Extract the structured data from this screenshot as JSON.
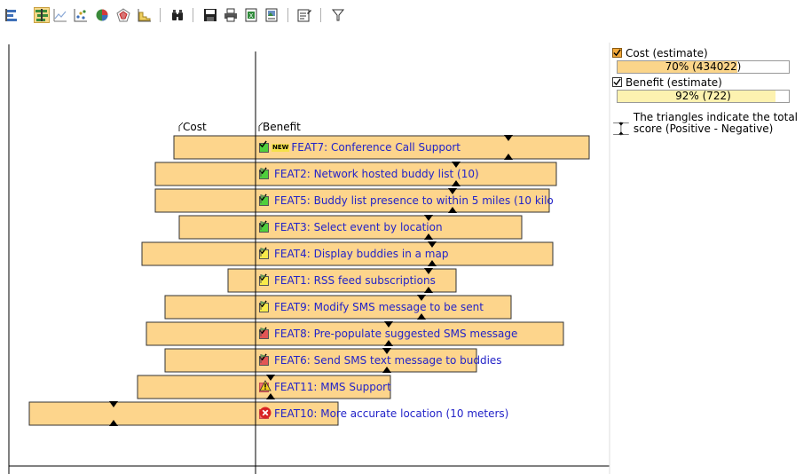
{
  "toolbar": {
    "buttons": [
      {
        "icon": "bars-left-icon",
        "tooltip": "",
        "active": false
      },
      {
        "icon": "bars-cost-benefit-icon",
        "tooltip": "",
        "active": true
      },
      {
        "icon": "line-chart-icon",
        "tooltip": "",
        "active": false
      },
      {
        "icon": "scatter-chart-icon",
        "tooltip": "",
        "active": false
      },
      {
        "icon": "pie-chart-icon",
        "tooltip": "",
        "active": false
      },
      {
        "icon": "radar-chart-icon",
        "tooltip": "",
        "active": false
      },
      {
        "icon": "area-chart-icon",
        "tooltip": "",
        "active": false
      },
      {
        "icon": "find-binoculars-icon",
        "tooltip": "",
        "active": false
      },
      {
        "icon": "save-icon",
        "tooltip": "",
        "active": false
      },
      {
        "icon": "print-icon",
        "tooltip": "",
        "active": false
      },
      {
        "icon": "export-excel-icon",
        "tooltip": "",
        "active": false
      },
      {
        "icon": "export-image-icon",
        "tooltip": "",
        "active": false
      },
      {
        "icon": "edit-properties-icon",
        "tooltip": "",
        "active": false
      },
      {
        "icon": "filter-icon",
        "tooltip": "",
        "active": false
      }
    ]
  },
  "chart_data": {
    "type": "bar",
    "chart_kind": "cost-benefit diverging bar",
    "columns": {
      "cost_label": "Cost",
      "benefit_label": "Benefit"
    },
    "categories": [
      "FEAT7: Conference Call Support",
      "FEAT2: Network hosted buddy list (10)",
      "FEAT5: Buddy list presence to within 5 miles (10 kilo",
      "FEAT3: Select event by location",
      "FEAT4: Display buddies in a map",
      "FEAT1: RSS feed subscriptions",
      "FEAT9: Modify SMS message to be sent",
      "FEAT8: Pre-populate suggested SMS message",
      "FEAT6: Send SMS text message to buddies",
      "FEAT11: MMS Support",
      "FEAT10: More accurate location (10 meters)"
    ],
    "status": [
      "green-new",
      "green",
      "green",
      "green",
      "yellow",
      "yellow",
      "yellow",
      "red",
      "red",
      "red-warning",
      "red-error"
    ],
    "series": [
      {
        "name": "Cost (estimate)",
        "values": [
          92,
          113,
          113,
          86,
          128,
          31,
          102,
          123,
          102,
          133,
          255
        ]
      },
      {
        "name": "Benefit (estimate)",
        "values": [
          376,
          339,
          331,
          300,
          335,
          226,
          288,
          347,
          249,
          152,
          93
        ]
      }
    ],
    "total_score_markers": [
      285,
      226,
      222,
      195,
      199,
      195,
      187,
      150,
      148,
      17,
      -160
    ],
    "grid": false,
    "legend_position": "right"
  },
  "legend": {
    "cost_label": "Cost (estimate)",
    "cost_text": "70% (434022)",
    "cost_fraction": 0.7,
    "cost_color": "#fbd58a",
    "benefit_label": "Benefit (estimate)",
    "benefit_text": "92% (722)",
    "benefit_fraction": 0.92,
    "benefit_color": "#fdf2b0",
    "triangle_note": "The triangles indicate the total score (Positive - Negative)"
  },
  "colors": {
    "bar_fill": "#fdd58c",
    "bar_stroke": "#333333",
    "link_text": "#2323c8"
  }
}
